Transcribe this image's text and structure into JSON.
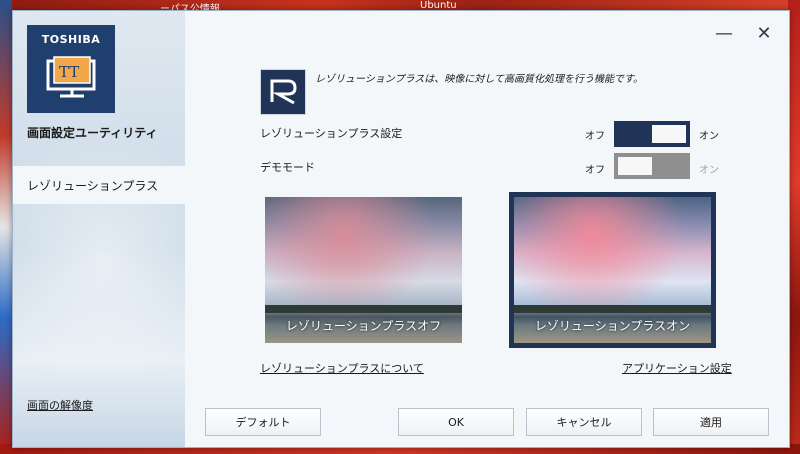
{
  "desktop": {
    "title_fragment_1": "ーパス公情報",
    "title_fragment_2": "Ubuntu"
  },
  "window": {
    "minimize_glyph": "—",
    "close_glyph": "✕"
  },
  "sidebar": {
    "brand": "TOSHIBA",
    "logo_glyph": "TT",
    "app_title": "画面設定ユーティリティ",
    "nav_items": [
      {
        "label": "レゾリューションプラス",
        "selected": true
      }
    ],
    "footer_link": "画面の解像度"
  },
  "content": {
    "description": "レゾリューションプラスは、映像に対して高画質化処理を行う機能です。",
    "settings": [
      {
        "label": "レゾリューションプラス設定",
        "off_label": "オフ",
        "on_label": "オン",
        "state": "on"
      },
      {
        "label": "デモモード",
        "off_label": "オフ",
        "on_label": "オン",
        "state": "off"
      }
    ],
    "preview_off_caption": "レゾリューションプラスオフ",
    "preview_on_caption": "レゾリューションプラスオン",
    "link_about": "レゾリューションプラスについて",
    "link_app_settings": "アプリケーション設定"
  },
  "buttons": {
    "default": "デフォルト",
    "ok": "OK",
    "cancel": "キャンセル",
    "apply": "適用"
  },
  "colors": {
    "accent": "#1f3457",
    "toggle_off": "#8f8f8f"
  }
}
